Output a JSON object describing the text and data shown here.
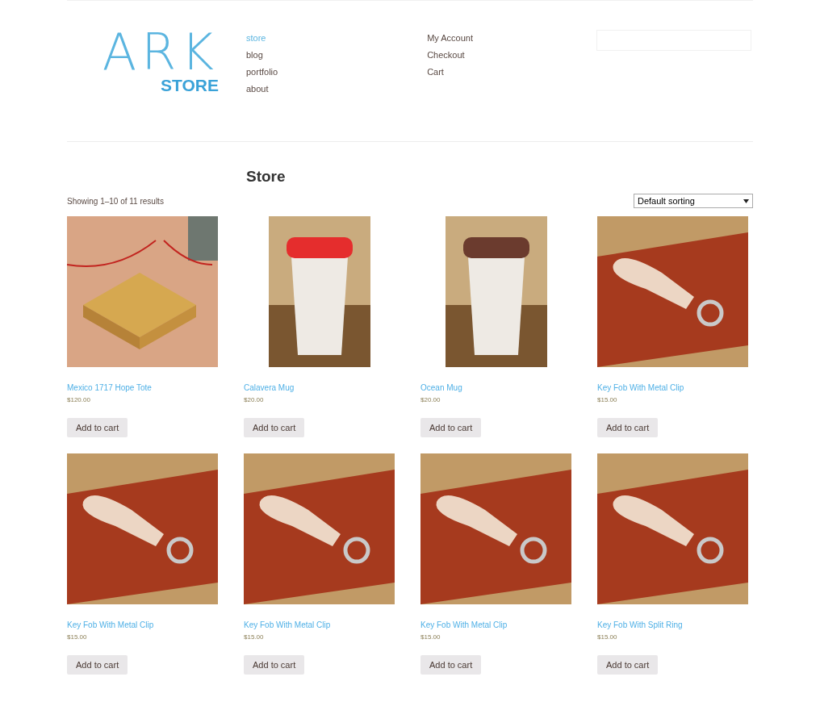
{
  "logo": {
    "title": "ARK",
    "subtitle": "STORE"
  },
  "nav": [
    {
      "label": "store",
      "selected": true
    },
    {
      "label": "blog",
      "selected": false
    },
    {
      "label": "portfolio",
      "selected": false
    },
    {
      "label": "about",
      "selected": false
    }
  ],
  "account_links": [
    "My Account",
    "Checkout",
    "Cart"
  ],
  "page_title": "Store",
  "result_count": "Showing 1–10 of 11 results",
  "sorting": {
    "value": "Default sorting"
  },
  "products": [
    {
      "name": "Mexico 1717 Hope Tote",
      "price": "$120.00",
      "kind": "box",
      "button": "Add to cart"
    },
    {
      "name": "Calavera Mug",
      "price": "$20.00",
      "kind": "mug",
      "color": "#e52d2d",
      "button": "Add to cart"
    },
    {
      "name": "Ocean Mug",
      "price": "$20.00",
      "kind": "mug",
      "color": "#6b3b2e",
      "button": "Add to cart"
    },
    {
      "name": "Key Fob With Metal Clip",
      "price": "$15.00",
      "kind": "keyfob",
      "button": "Add to cart"
    },
    {
      "name": "Key Fob With Metal Clip",
      "price": "$15.00",
      "kind": "keyfob",
      "button": "Add to cart"
    },
    {
      "name": "Key Fob With Metal Clip",
      "price": "$15.00",
      "kind": "keyfob",
      "button": "Add to cart"
    },
    {
      "name": "Key Fob With Metal Clip",
      "price": "$15.00",
      "kind": "keyfob",
      "button": "Add to cart"
    },
    {
      "name": "Key Fob With Split Ring",
      "price": "$15.00",
      "kind": "keyfob",
      "button": "Add to cart"
    }
  ]
}
